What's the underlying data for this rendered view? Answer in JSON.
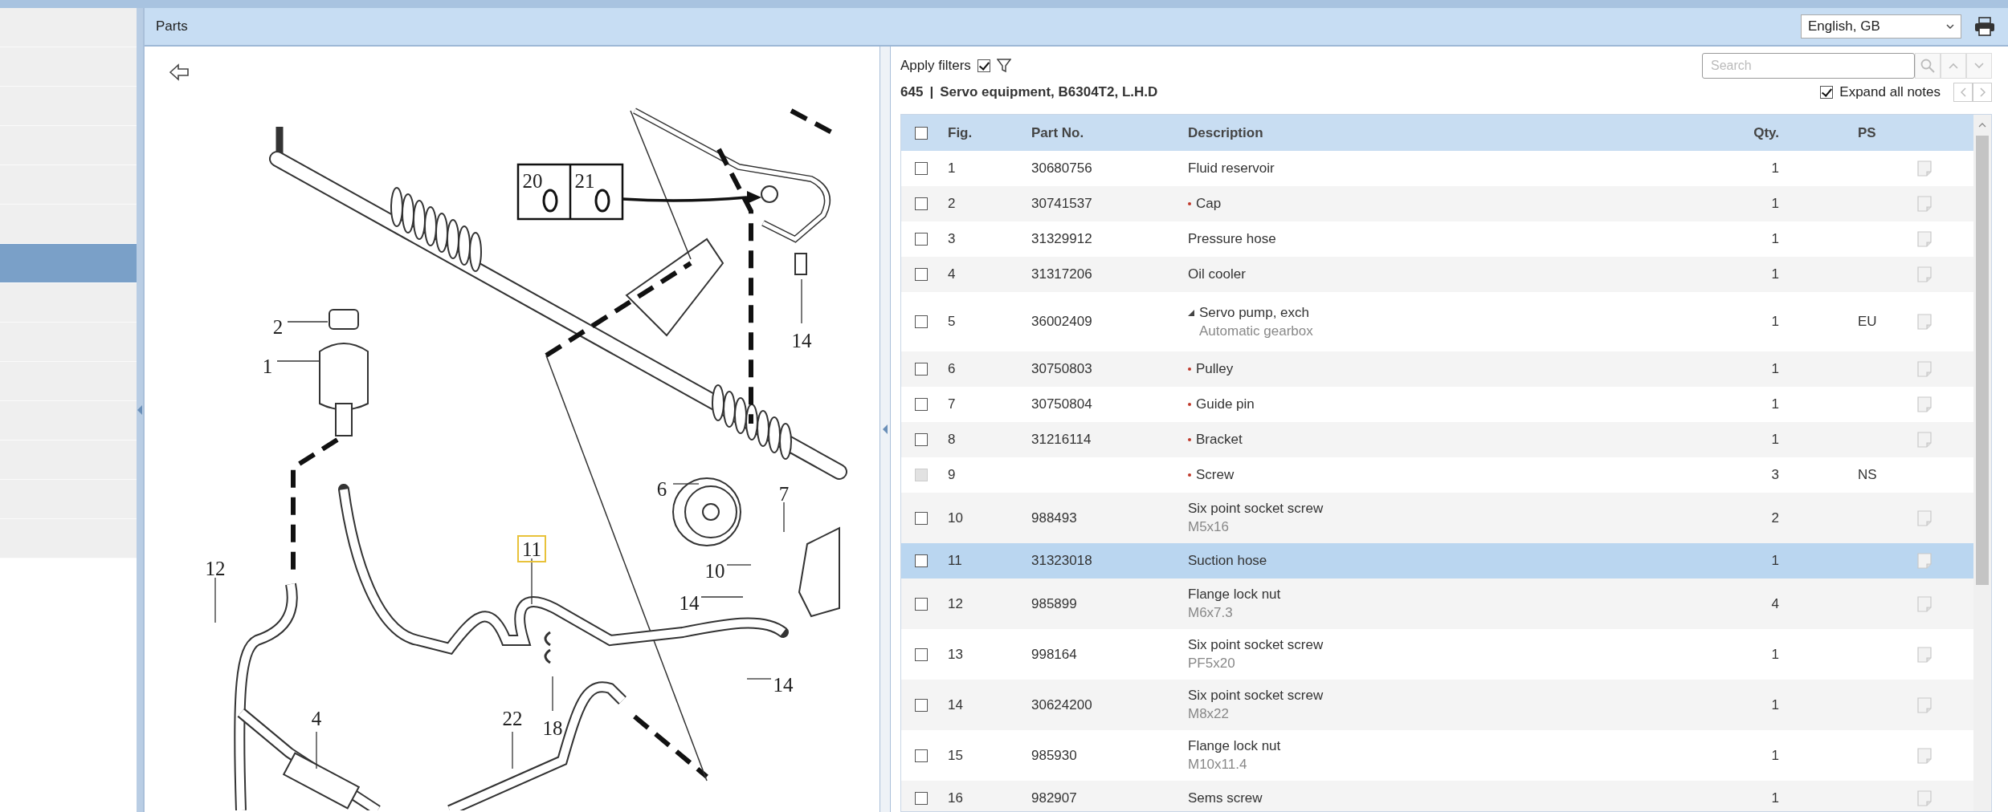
{
  "sidebar": {
    "items": [
      {
        "selected": false
      },
      {
        "selected": false
      },
      {
        "selected": false
      },
      {
        "selected": false
      },
      {
        "selected": false
      },
      {
        "selected": false
      },
      {
        "selected": true
      },
      {
        "selected": false
      },
      {
        "selected": false
      },
      {
        "selected": false
      },
      {
        "selected": false
      },
      {
        "selected": false
      },
      {
        "selected": false
      },
      {
        "selected": false
      }
    ]
  },
  "panel": {
    "title": "Parts",
    "language": "English, GB"
  },
  "diagram": {
    "callouts": [
      {
        "label": "20",
        "selected": false
      },
      {
        "label": "21",
        "selected": false
      },
      {
        "label": "14",
        "selected": false
      },
      {
        "label": "2",
        "selected": false
      },
      {
        "label": "1",
        "selected": false
      },
      {
        "label": "6",
        "selected": false
      },
      {
        "label": "7",
        "selected": false
      },
      {
        "label": "12",
        "selected": false
      },
      {
        "label": "11",
        "selected": true
      },
      {
        "label": "10",
        "selected": false
      },
      {
        "label": "14",
        "selected": false
      },
      {
        "label": "14",
        "selected": false
      },
      {
        "label": "4",
        "selected": false
      },
      {
        "label": "22",
        "selected": false
      },
      {
        "label": "18",
        "selected": false
      }
    ]
  },
  "filters": {
    "label": "Apply filters",
    "checked": true
  },
  "search": {
    "placeholder": "Search"
  },
  "group": {
    "number": "645",
    "separator": "|",
    "name": "Servo equipment, B6304T2, L.H.D"
  },
  "expand_notes": {
    "label": "Expand all notes",
    "checked": true
  },
  "table": {
    "columns": [
      "Fig.",
      "Part No.",
      "Description",
      "Qty.",
      "PS"
    ],
    "header_checked": false,
    "rows": [
      {
        "fig": "1",
        "part_no": "30680756",
        "description": "Fluid reservoir",
        "qty": "1",
        "checked": false,
        "disabled": false,
        "selected": false,
        "bullet": false,
        "note": true
      },
      {
        "fig": "2",
        "part_no": "30741537",
        "description": "Cap",
        "qty": "1",
        "checked": false,
        "disabled": false,
        "selected": false,
        "bullet": true,
        "note": true
      },
      {
        "fig": "3",
        "part_no": "31329912",
        "description": "Pressure hose",
        "qty": "1",
        "checked": false,
        "disabled": false,
        "selected": false,
        "bullet": false,
        "note": true
      },
      {
        "fig": "4",
        "part_no": "31317206",
        "description": "Oil cooler",
        "qty": "1",
        "checked": false,
        "disabled": false,
        "selected": false,
        "bullet": false,
        "note": true
      },
      {
        "fig": "5",
        "part_no": "36002409",
        "description": "Servo pump, exch",
        "sub": "Automatic gearbox",
        "qty": "1",
        "ps": "EU",
        "checked": false,
        "disabled": false,
        "selected": false,
        "bullet": false,
        "expanded": true,
        "note": true
      },
      {
        "fig": "6",
        "part_no": "30750803",
        "description": "Pulley",
        "qty": "1",
        "checked": false,
        "disabled": false,
        "selected": false,
        "bullet": true,
        "note": true
      },
      {
        "fig": "7",
        "part_no": "30750804",
        "description": "Guide pin",
        "qty": "1",
        "checked": false,
        "disabled": false,
        "selected": false,
        "bullet": true,
        "note": true
      },
      {
        "fig": "8",
        "part_no": "31216114",
        "description": "Bracket",
        "qty": "1",
        "checked": false,
        "disabled": false,
        "selected": false,
        "bullet": true,
        "note": true
      },
      {
        "fig": "9",
        "description": "Screw",
        "qty": "3",
        "ps": "NS",
        "checked": false,
        "disabled": true,
        "selected": false,
        "bullet": true,
        "note": false
      },
      {
        "fig": "10",
        "part_no": "988493",
        "description": "Six point socket screw",
        "sub": "M5x16",
        "qty": "2",
        "checked": false,
        "disabled": false,
        "selected": false,
        "bullet": false,
        "note": true
      },
      {
        "fig": "11",
        "part_no": "31323018",
        "description": "Suction hose",
        "qty": "1",
        "checked": false,
        "disabled": false,
        "selected": true,
        "bullet": false,
        "note": true
      },
      {
        "fig": "12",
        "part_no": "985899",
        "description": "Flange lock nut",
        "sub": "M6x7.3",
        "qty": "4",
        "checked": false,
        "disabled": false,
        "selected": false,
        "bullet": false,
        "note": true
      },
      {
        "fig": "13",
        "part_no": "998164",
        "description": "Six point socket screw",
        "sub": "PF5x20",
        "qty": "1",
        "checked": false,
        "disabled": false,
        "selected": false,
        "bullet": false,
        "note": true
      },
      {
        "fig": "14",
        "part_no": "30624200",
        "description": "Six point socket screw",
        "sub": "M8x22",
        "qty": "1",
        "checked": false,
        "disabled": false,
        "selected": false,
        "bullet": false,
        "note": true
      },
      {
        "fig": "15",
        "part_no": "985930",
        "description": "Flange lock nut",
        "sub": "M10x11.4",
        "qty": "1",
        "checked": false,
        "disabled": false,
        "selected": false,
        "bullet": false,
        "note": true
      },
      {
        "fig": "16",
        "part_no": "982907",
        "description": "Sems screw",
        "qty": "1",
        "checked": false,
        "disabled": false,
        "selected": false,
        "bullet": false,
        "note": true
      }
    ]
  }
}
